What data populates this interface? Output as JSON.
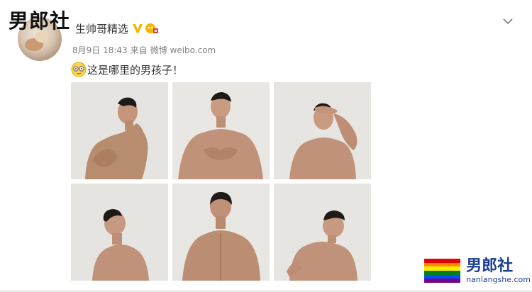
{
  "watermark_top": "男郎社",
  "post": {
    "username": "生帅哥精选",
    "timestamp": "8月9日 18:43",
    "source_prefix": "来自",
    "source": "微博 weibo.com",
    "text": "这是哪里的男孩子！"
  },
  "photos": [
    {
      "name": "photo-1"
    },
    {
      "name": "photo-2"
    },
    {
      "name": "photo-3"
    },
    {
      "name": "photo-4"
    },
    {
      "name": "photo-5"
    },
    {
      "name": "photo-6"
    }
  ],
  "watermark_bottom": {
    "brand": "男郎社",
    "url": "nanlangshe.com"
  },
  "colors": {
    "verify": "#f7b500",
    "watermark_blue": "#1b3f95",
    "rainbow": [
      "#e40303",
      "#ff8c00",
      "#ffed00",
      "#008026",
      "#004dff",
      "#750787"
    ]
  },
  "icons": {
    "verify": "verified-v-icon",
    "member": "member-badge-icon",
    "chevron": "chevron-down-icon",
    "emoji": "emoji-icon"
  }
}
